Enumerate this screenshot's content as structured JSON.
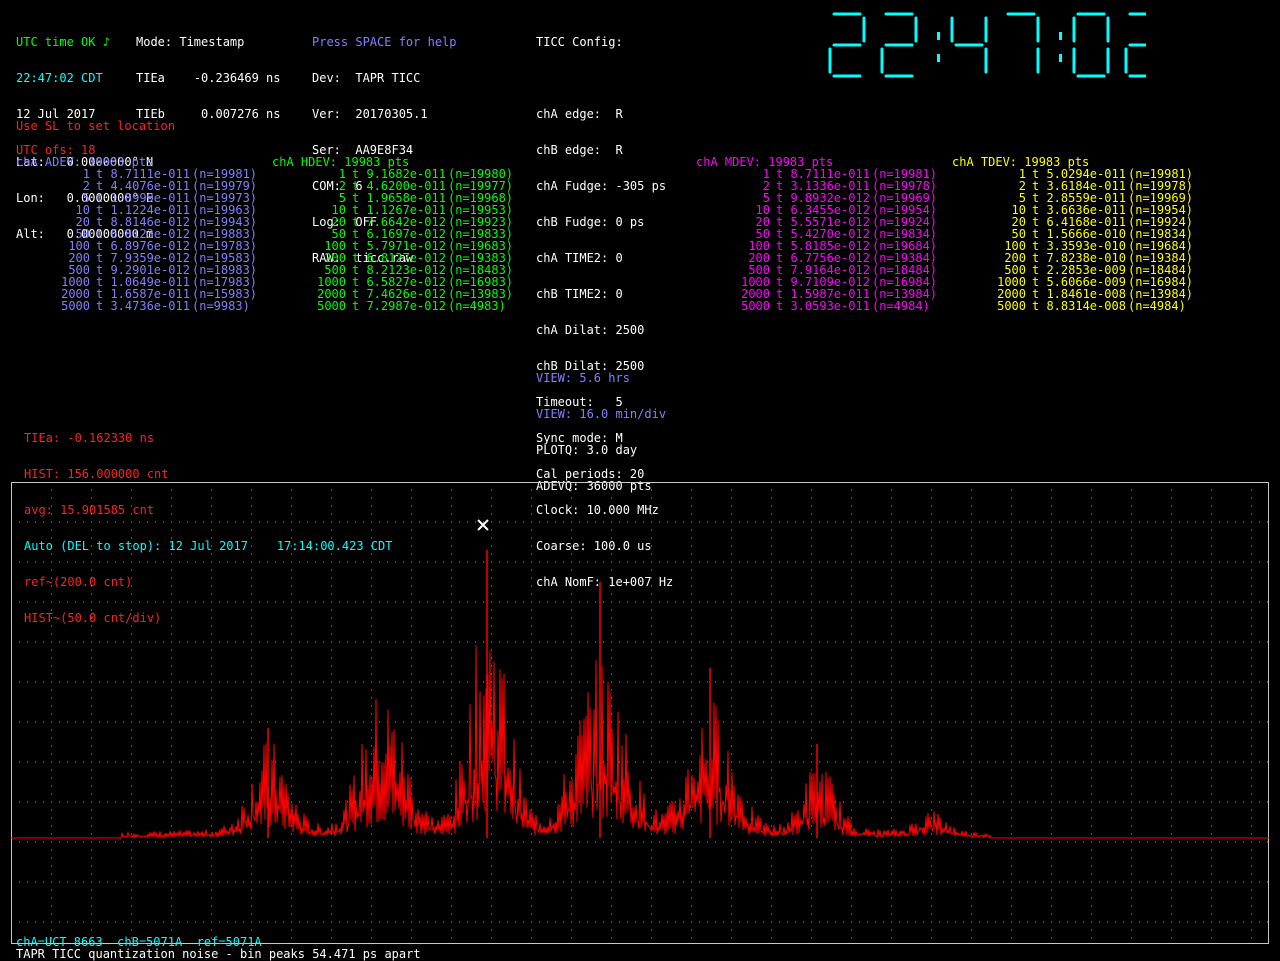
{
  "status": {
    "utc_ok": "UTC time OK",
    "note_icon": "♪",
    "time": "22:47:02 CDT",
    "date": "12 Jul 2017",
    "utc_ofs": "UTC ofs: 18"
  },
  "mode": {
    "line1": "Mode: Timestamp",
    "line2": "TIEa    -0.236469 ns",
    "line3": "TIEb     0.007276 ns"
  },
  "device": {
    "help": "Press SPACE for help",
    "lines": [
      "Dev:  TAPR TICC",
      "Ver:  20170305.1",
      "Ser:  AA9E8F34",
      "COM:  6",
      "Log:  OFF",
      "RAW:  ticc.raw"
    ]
  },
  "config": {
    "title": "TICC Config:",
    "lines": [
      "chA edge:  R",
      "chB edge:  R",
      "chA Fudge: -305 ps",
      "chB Fudge: 0 ps",
      "chA TIME2: 0",
      "chB TIME2: 0",
      "chA Dilat: 2500",
      "chB Dilat: 2500",
      "Timeout:   5",
      "Sync mode: M",
      "Cal periods: 20",
      "Clock: 10.000 MHz",
      "Coarse: 100.0 us",
      "chA NomF: 1e+007 Hz"
    ]
  },
  "location": {
    "title": "Use SL to set location",
    "lines": [
      "Lat:   0.0000000° N",
      "Lon:   0.0000000° E",
      "Alt:   0.00000000 m"
    ]
  },
  "clock": {
    "digits": "22:47:02",
    "color": "#00ffff"
  },
  "adev_tables": [
    {
      "title": "chA ADEV: 19983 pts",
      "color": "#8080ff",
      "rows": [
        {
          "tau": "1",
          "val": "t 8.7111e-011",
          "n": "(n=19981)"
        },
        {
          "tau": "2",
          "val": "t 4.4076e-011",
          "n": "(n=19979)"
        },
        {
          "tau": "5",
          "val": "t 1.8999e-011",
          "n": "(n=19973)"
        },
        {
          "tau": "10",
          "val": "t 1.1224e-011",
          "n": "(n=19963)"
        },
        {
          "tau": "20",
          "val": "t 8.8146e-012",
          "n": "(n=19943)"
        },
        {
          "tau": "50",
          "val": "t 6.8123e-012",
          "n": "(n=19883)"
        },
        {
          "tau": "100",
          "val": "t 6.8976e-012",
          "n": "(n=19783)"
        },
        {
          "tau": "200",
          "val": "t 7.9359e-012",
          "n": "(n=19583)"
        },
        {
          "tau": "500",
          "val": "t 9.2901e-012",
          "n": "(n=18983)"
        },
        {
          "tau": "1000",
          "val": "t 1.0649e-011",
          "n": "(n=17983)"
        },
        {
          "tau": "2000",
          "val": "t 1.6587e-011",
          "n": "(n=15983)"
        },
        {
          "tau": "5000",
          "val": "t 3.4736e-011",
          "n": "(n=9983)"
        }
      ]
    },
    {
      "title": "chA HDEV: 19983 pts",
      "color": "#00ff00",
      "rows": [
        {
          "tau": "1",
          "val": "t 9.1682e-011",
          "n": "(n=19980)"
        },
        {
          "tau": "2",
          "val": "t 4.6200e-011",
          "n": "(n=19977)"
        },
        {
          "tau": "5",
          "val": "t 1.9658e-011",
          "n": "(n=19968)"
        },
        {
          "tau": "10",
          "val": "t 1.1267e-011",
          "n": "(n=19953)"
        },
        {
          "tau": "20",
          "val": "t 7.6642e-012",
          "n": "(n=19923)"
        },
        {
          "tau": "50",
          "val": "t 6.1697e-012",
          "n": "(n=19833)"
        },
        {
          "tau": "100",
          "val": "t 5.7971e-012",
          "n": "(n=19683)"
        },
        {
          "tau": "200",
          "val": "t 6.8127e-012",
          "n": "(n=19383)"
        },
        {
          "tau": "500",
          "val": "t 8.2123e-012",
          "n": "(n=18483)"
        },
        {
          "tau": "1000",
          "val": "t 6.5827e-012",
          "n": "(n=16983)"
        },
        {
          "tau": "2000",
          "val": "t 7.4626e-012",
          "n": "(n=13983)"
        },
        {
          "tau": "5000",
          "val": "t 7.2987e-012",
          "n": "(n=4983)"
        }
      ]
    },
    {
      "title": "chA MDEV: 19983 pts",
      "color": "#ff00ff",
      "rows": [
        {
          "tau": "1",
          "val": "t 8.7111e-011",
          "n": "(n=19981)"
        },
        {
          "tau": "2",
          "val": "t 3.1336e-011",
          "n": "(n=19978)"
        },
        {
          "tau": "5",
          "val": "t 9.8932e-012",
          "n": "(n=19969)"
        },
        {
          "tau": "10",
          "val": "t 6.3455e-012",
          "n": "(n=19954)"
        },
        {
          "tau": "20",
          "val": "t 5.5571e-012",
          "n": "(n=19924)"
        },
        {
          "tau": "50",
          "val": "t 5.4270e-012",
          "n": "(n=19834)"
        },
        {
          "tau": "100",
          "val": "t 5.8185e-012",
          "n": "(n=19684)"
        },
        {
          "tau": "200",
          "val": "t 6.7756e-012",
          "n": "(n=19384)"
        },
        {
          "tau": "500",
          "val": "t 7.9164e-012",
          "n": "(n=18484)"
        },
        {
          "tau": "1000",
          "val": "t 9.7109e-012",
          "n": "(n=16984)"
        },
        {
          "tau": "2000",
          "val": "t 1.5987e-011",
          "n": "(n=13984)"
        },
        {
          "tau": "5000",
          "val": "t 3.0593e-011",
          "n": "(n=4984)"
        }
      ]
    },
    {
      "title": "chA TDEV: 19983 pts",
      "color": "#ffff00",
      "rows": [
        {
          "tau": "1",
          "val": "t 5.0294e-011",
          "n": "(n=19981)"
        },
        {
          "tau": "2",
          "val": "t 3.6184e-011",
          "n": "(n=19978)"
        },
        {
          "tau": "5",
          "val": "t 2.8559e-011",
          "n": "(n=19969)"
        },
        {
          "tau": "10",
          "val": "t 3.6636e-011",
          "n": "(n=19954)"
        },
        {
          "tau": "20",
          "val": "t 6.4168e-011",
          "n": "(n=19924)"
        },
        {
          "tau": "50",
          "val": "t 1.5666e-010",
          "n": "(n=19834)"
        },
        {
          "tau": "100",
          "val": "t 3.3593e-010",
          "n": "(n=19684)"
        },
        {
          "tau": "200",
          "val": "t 7.8238e-010",
          "n": "(n=19384)"
        },
        {
          "tau": "500",
          "val": "t 2.2853e-009",
          "n": "(n=18484)"
        },
        {
          "tau": "1000",
          "val": "t 5.6066e-009",
          "n": "(n=16984)"
        },
        {
          "tau": "2000",
          "val": "t 1.8461e-008",
          "n": "(n=13984)"
        },
        {
          "tau": "5000",
          "val": "t 8.8314e-008",
          "n": "(n=4984)"
        }
      ]
    }
  ],
  "view": {
    "view_hrs": "VIEW: 5.6 hrs",
    "view_div": "VIEW: 16.0 min/div",
    "plotq": "PLOTQ: 3.0 day",
    "adevq": "ADEVQ: 36000 pts"
  },
  "hist_info": {
    "tiea": "TIEa: -0.162330 ns",
    "hist": "HIST: 156.000000 cnt",
    "avg": "avg: 15.901585 cnt",
    "auto": "Auto (DEL to stop): 12 Jul 2017    17:14:00.423 CDT",
    "ref": "ref~(200.0 cnt)",
    "scale": "HIST~(50.0 cnt/div)"
  },
  "plot": {
    "grid_color": "#c8c8c8",
    "trace_color": "#ff0000",
    "cursor_icon": "x-cursor"
  },
  "footer": {
    "channels": "chA=UCT 8663  chB=5071A  ref=5071A",
    "title": "TAPR TICC quantization noise - bin peaks 54.471 ps apart"
  }
}
